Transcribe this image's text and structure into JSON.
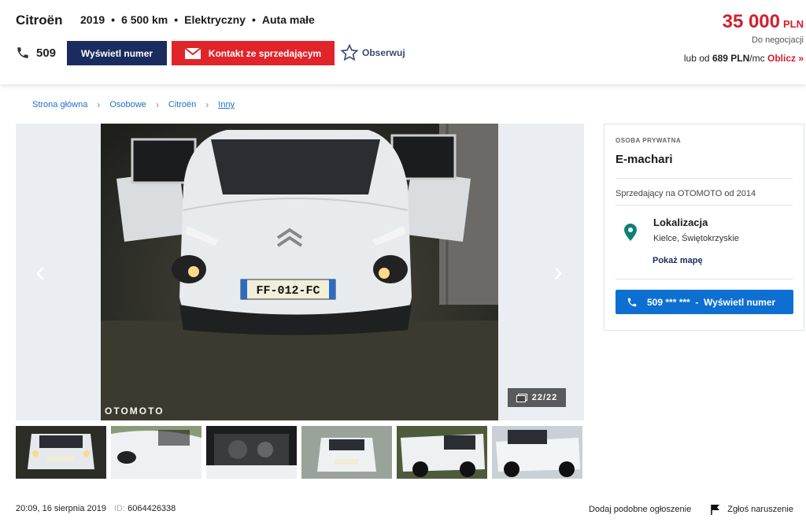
{
  "header": {
    "brand": "Citroën",
    "params": [
      "2019",
      "6 500 km",
      "Elektryczny",
      "Auta małe"
    ],
    "phone_prefix": "509",
    "show_number_label": "Wyświetl numer",
    "contact_label": "Kontakt ze sprzedającym",
    "observe_label": "Obserwuj",
    "price_amount": "35 000",
    "price_currency": "PLN",
    "negotiable": "Do negocjacji",
    "installment_prefix": "lub od",
    "installment_amount": "689 PLN",
    "installment_suffix": "/mc",
    "installment_calc": "Oblicz »"
  },
  "breadcrumb": [
    "Strona główna",
    "Osobowe",
    "Citroën",
    "Inny"
  ],
  "gallery": {
    "counter": "22/22",
    "watermark": "OTOMOTO",
    "plate": "FF-012-FC"
  },
  "seller": {
    "type": "OSOBA PRYWATNA",
    "name": "E-machari",
    "since": "Sprzedający na OTOMOTO od 2014",
    "location_title": "Lokalizacja",
    "location_value": "Kielce, Świętokrzyskie",
    "map_label": "Pokaż mapę",
    "phone_button": "509 *** ***  -  Wyświetl numer"
  },
  "footer": {
    "date": "20:09, 16 sierpnia 2019",
    "id_label": "ID:",
    "id_value": "6064426338",
    "similar_label": "Dodaj podobne ogłoszenie",
    "report_label": "Zgłoś naruszenie"
  },
  "colors": {
    "price_red": "#d1202c",
    "navy": "#1a2b5e",
    "contact_red": "#e0242a",
    "link_blue": "#1f6fc9",
    "phone_blue": "#0d6fd1",
    "pin_teal": "#0e7f78"
  }
}
